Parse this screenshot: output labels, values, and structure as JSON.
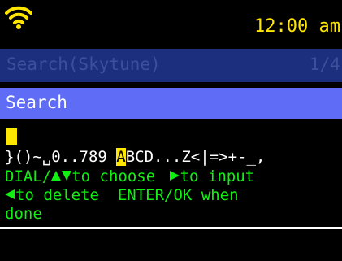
{
  "status": {
    "time": "12:00 am",
    "wifi_icon": "wifi-signal-icon"
  },
  "header": {
    "title": "Search(Skytune)",
    "page": "1/4"
  },
  "search": {
    "label": "Search",
    "value": ""
  },
  "charset": {
    "before": "}()~␣0..789 ",
    "selected": "A",
    "after": "BCD...Z<|=>+-_,"
  },
  "help": {
    "line1_prefix": "DIAL/",
    "line1_mid": "to choose ",
    "line1_end": "to input",
    "line2_text": "to delete  ENTER/OK when",
    "line3": "done"
  },
  "colors": {
    "accent_yellow": "#ffe600",
    "help_green": "#12ef12",
    "header_bg": "#1b2f7e",
    "selected_bg": "#5e6cf6"
  }
}
